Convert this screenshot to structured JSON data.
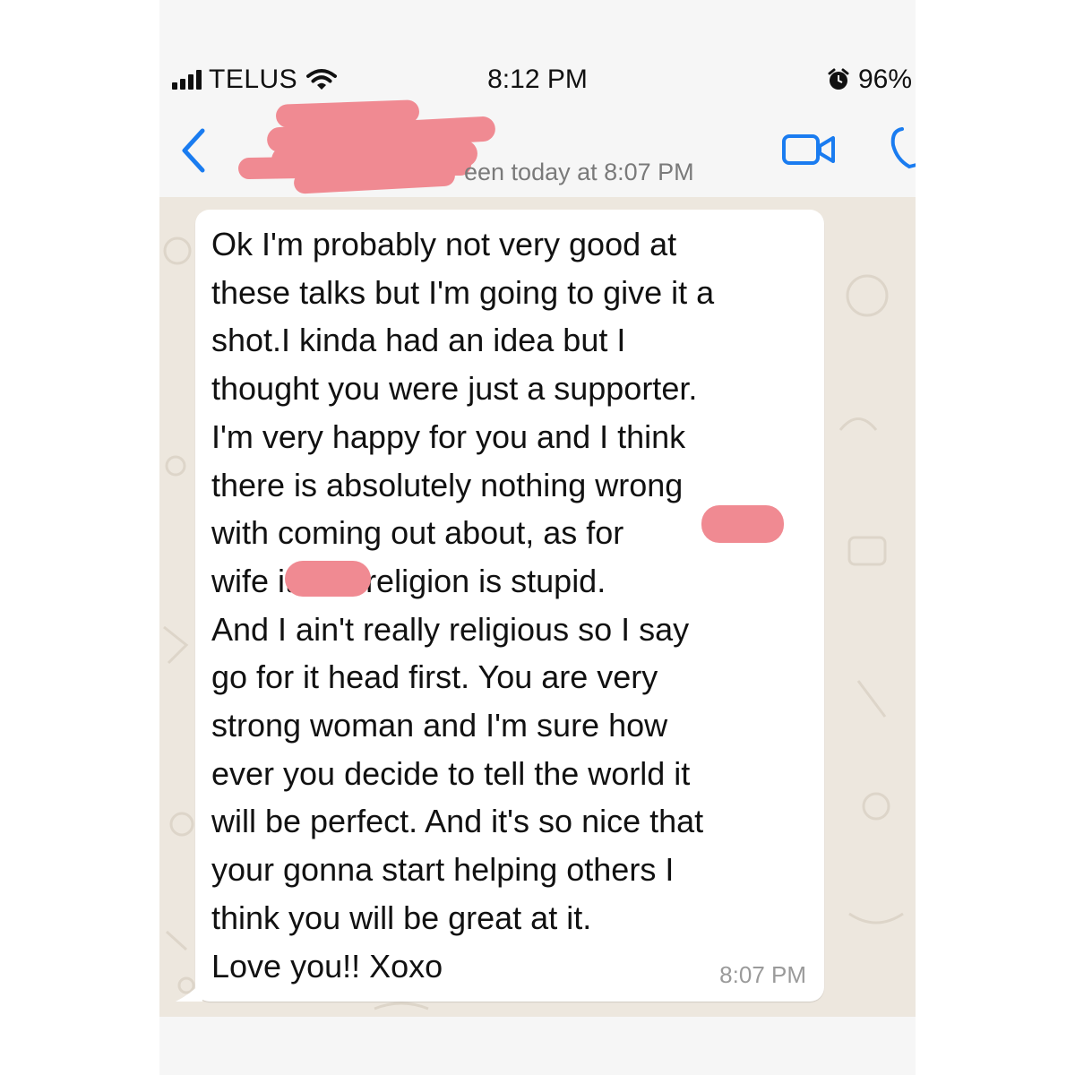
{
  "status_bar": {
    "carrier": "TELUS",
    "time": "8:12 PM",
    "battery": "96%",
    "icons": [
      "signal-icon",
      "wifi-icon",
      "alarm-icon"
    ]
  },
  "header": {
    "last_seen_fragment": "een today at 8:07 PM",
    "icons": [
      "back-chevron-icon",
      "video-call-icon",
      "phone-call-icon"
    ]
  },
  "message": {
    "text": "Ok I'm probably not very good at\nthese talks but I'm going to give it a\nshot.I kinda had an idea but I\nthought you were just a supporter.\nI'm very happy for you and I think\nthere is absolutely nothing wrong\nwith coming out about, as for\nwife           it that religion is stupid.\nAnd I ain't really religious so I say\ngo for it head first. You are very\nstrong woman and I'm sure how\never you decide to tell the world it\nwill be perfect. And it's so nice that\nyour gonna start helping others I\nthink you will be great at it.\nLove you!! Xoxo",
    "time": "8:07 PM"
  },
  "colors": {
    "accent": "#1a7cf0",
    "redaction": "#f08a92",
    "wallpaper": "#ede7de",
    "bubble": "#ffffff"
  }
}
